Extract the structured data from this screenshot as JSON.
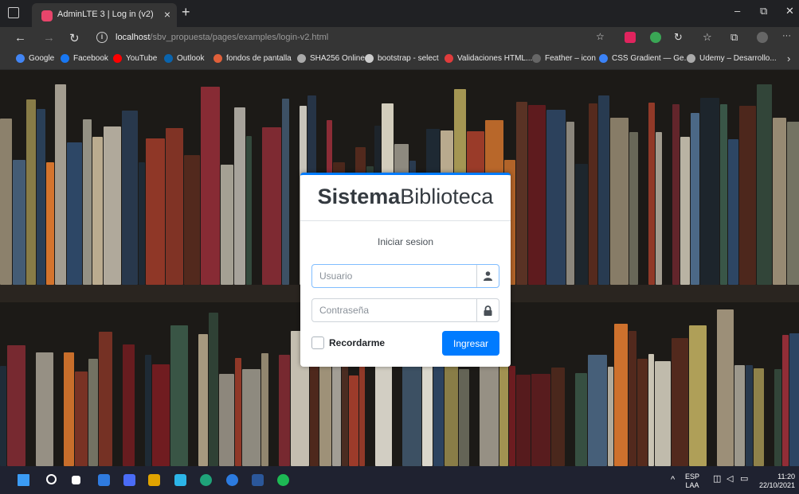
{
  "browser": {
    "tab_title": "AdminLTE 3 | Log in (v2)",
    "tab_close": "×",
    "new_tab": "+",
    "url_host": "localhost",
    "url_path": "/sbv_propuesta/pages/examples/login-v2.html",
    "win_min": "–",
    "win_max": "⧉",
    "win_close": "✕",
    "more": "···"
  },
  "bookmarks": [
    {
      "label": "Google",
      "color": "#4285f4"
    },
    {
      "label": "Facebook",
      "color": "#1877f2"
    },
    {
      "label": "YouTube",
      "color": "#ff0000"
    },
    {
      "label": "Outlook",
      "color": "#0a64ad"
    },
    {
      "label": "fondos de pantalla",
      "color": "#e0603a"
    },
    {
      "label": "SHA256 Online",
      "color": "#aaaaaa"
    },
    {
      "label": "bootstrap - select",
      "color": "#cccccc"
    },
    {
      "label": "Validaciones HTML...",
      "color": "#e03c3c"
    },
    {
      "label": "Feather – icon",
      "color": "#666666"
    },
    {
      "label": "CSS Gradient — Ge...",
      "color": "#3b82f6"
    },
    {
      "label": "Udemy – Desarrollo...",
      "color": "#aaaaaa"
    }
  ],
  "login": {
    "logo_bold": "Sistema",
    "logo_rest": "Biblioteca",
    "message": "Iniciar sesion",
    "username_placeholder": "Usuario",
    "password_placeholder": "Contraseña",
    "remember_label": "Recordarme",
    "submit_label": "Ingresar"
  },
  "taskbar": {
    "lang_top": "ESP",
    "lang_bottom": "LAA",
    "time": "11:20",
    "date": "22/10/2021"
  },
  "colors": {
    "primary": "#007bff",
    "chrome_dark": "#202124",
    "chrome_bar": "#353535"
  }
}
